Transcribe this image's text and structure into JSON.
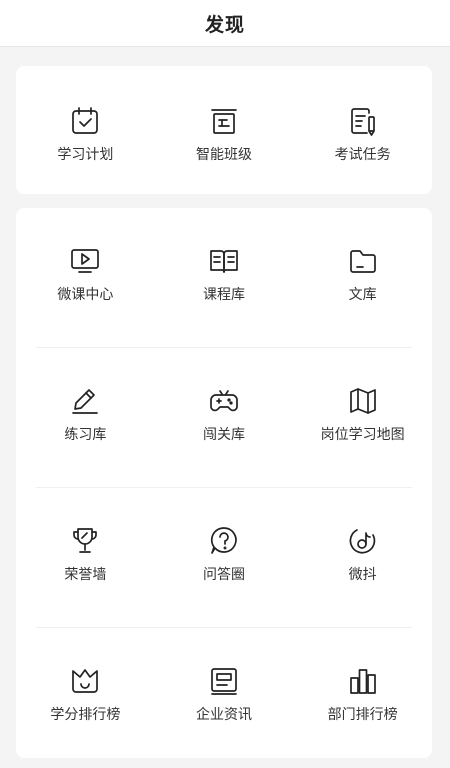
{
  "header": {
    "title": "发现"
  },
  "top_card": {
    "items": [
      {
        "label": "学习计划",
        "icon": "calendar-check-icon"
      },
      {
        "label": "智能班级",
        "icon": "class-board-icon"
      },
      {
        "label": "考试任务",
        "icon": "exam-note-icon"
      }
    ]
  },
  "grid": {
    "rows": [
      [
        {
          "label": "微课中心",
          "icon": "video-play-icon"
        },
        {
          "label": "课程库",
          "icon": "open-book-icon"
        },
        {
          "label": "文库",
          "icon": "folder-icon"
        }
      ],
      [
        {
          "label": "练习库",
          "icon": "pen-icon"
        },
        {
          "label": "闯关库",
          "icon": "gamepad-icon"
        },
        {
          "label": "岗位学习地图",
          "icon": "map-icon"
        }
      ],
      [
        {
          "label": "荣誉墙",
          "icon": "trophy-icon"
        },
        {
          "label": "问答圈",
          "icon": "question-bubble-icon"
        },
        {
          "label": "微抖",
          "icon": "music-note-icon"
        }
      ],
      [
        {
          "label": "学分排行榜",
          "icon": "crown-icon"
        },
        {
          "label": "企业资讯",
          "icon": "news-icon"
        },
        {
          "label": "部门排行榜",
          "icon": "bar-chart-icon"
        }
      ]
    ]
  }
}
